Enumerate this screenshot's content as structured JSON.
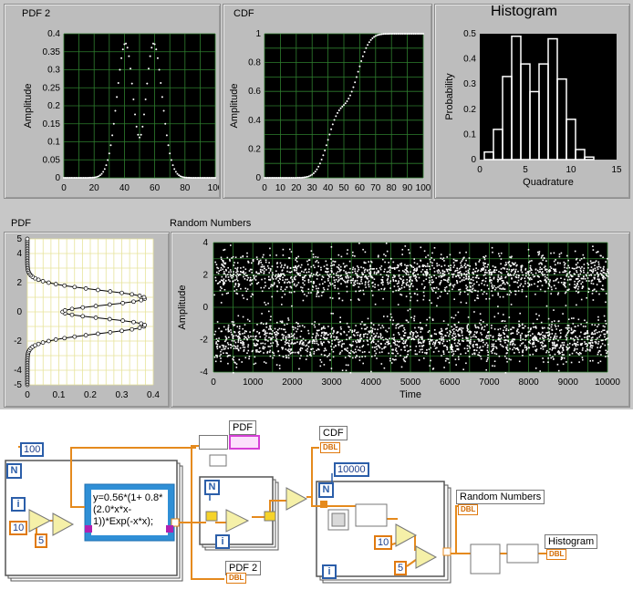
{
  "front_panel": {
    "pdf2": {
      "label": "PDF 2",
      "ylabel": "Amplitude",
      "xticks": [
        "0",
        "20",
        "40",
        "60",
        "80",
        "100"
      ],
      "yticks": [
        "0",
        "0.05",
        "0.1",
        "0.15",
        "0.2",
        "0.25",
        "0.3",
        "0.35",
        "0.4"
      ]
    },
    "cdf": {
      "label": "CDF",
      "ylabel": "Amplitude",
      "xticks": [
        "0",
        "10",
        "20",
        "30",
        "40",
        "50",
        "60",
        "70",
        "80",
        "90",
        "100"
      ],
      "yticks": [
        "0",
        "0.2",
        "0.4",
        "0.6",
        "0.8",
        "1"
      ]
    },
    "histogram": {
      "title": "Histogram",
      "xlabel": "Quadrature",
      "ylabel": "Probability",
      "xticks": [
        "0",
        "5",
        "10",
        "15"
      ],
      "yticks": [
        "0",
        "0.1",
        "0.2",
        "0.3",
        "0.4",
        "0.5"
      ]
    },
    "pdf": {
      "label": "PDF",
      "xticks": [
        "0",
        "0.1",
        "0.2",
        "0.3",
        "0.4"
      ],
      "yticks": [
        "5",
        "4",
        "2",
        "0",
        "-2",
        "-4",
        "-5"
      ]
    },
    "random": {
      "label": "Random Numbers",
      "xlabel": "Time",
      "ylabel": "Amplitude",
      "xticks": [
        "0",
        "1000",
        "2000",
        "3000",
        "4000",
        "5000",
        "6000",
        "7000",
        "8000",
        "9000",
        "10000"
      ],
      "yticks": [
        "4",
        "2",
        "0",
        "-2",
        "-4"
      ]
    }
  },
  "chart_data": [
    {
      "type": "scatter",
      "name": "PDF 2",
      "xlim": [
        0,
        100
      ],
      "ylim": [
        0,
        0.4
      ],
      "peaks": [
        {
          "x": 40,
          "y": 0.37
        },
        {
          "x": 60,
          "y": 0.37
        }
      ],
      "dip": {
        "x": 50,
        "y": 0.11
      }
    },
    {
      "type": "line",
      "name": "CDF",
      "xlim": [
        0,
        100
      ],
      "ylim": [
        0,
        1
      ],
      "x": [
        20,
        30,
        35,
        40,
        45,
        50,
        55,
        60,
        65,
        70,
        80,
        100
      ],
      "y": [
        0,
        0.01,
        0.05,
        0.15,
        0.3,
        0.43,
        0.55,
        0.75,
        0.95,
        0.99,
        1,
        1
      ]
    },
    {
      "type": "bar",
      "name": "Histogram",
      "xlim": [
        0,
        15
      ],
      "ylim": [
        0,
        0.5
      ],
      "bin_centers": [
        1,
        2,
        3,
        4,
        5,
        6,
        7,
        8,
        9,
        10,
        11,
        12
      ],
      "values": [
        0.03,
        0.12,
        0.33,
        0.49,
        0.38,
        0.27,
        0.38,
        0.48,
        0.32,
        0.16,
        0.04,
        0.01
      ]
    },
    {
      "type": "line",
      "name": "PDF",
      "xlim": [
        0,
        0.4
      ],
      "ylim": [
        -5,
        5
      ],
      "peaks": [
        {
          "y": 2,
          "x": 0.37
        },
        {
          "y": -2,
          "x": 0.37
        }
      ],
      "dip": {
        "y": 0,
        "x": 0.11
      }
    },
    {
      "type": "scatter",
      "name": "Random Numbers",
      "xlim": [
        0,
        10000
      ],
      "ylim": [
        -4,
        4
      ],
      "n_points": 10000,
      "clusters": [
        2,
        -2
      ],
      "spread": 0.8
    }
  ],
  "diagram": {
    "pdf_label": "PDF",
    "cdf_label": "CDF",
    "pdf2_label": "PDF 2",
    "random_label": "Random Numbers",
    "histogram_label": "Histogram",
    "n_100": "100",
    "n_10000": "10000",
    "const_10a": "10",
    "const_5a": "5",
    "const_10b": "10",
    "const_5b": "5",
    "formula": "y=0.56*(1+ 0.8*(2.0*x*x- 1))*Exp(-x*x);",
    "N": "N",
    "i": "i",
    "dbl": "DBL"
  }
}
